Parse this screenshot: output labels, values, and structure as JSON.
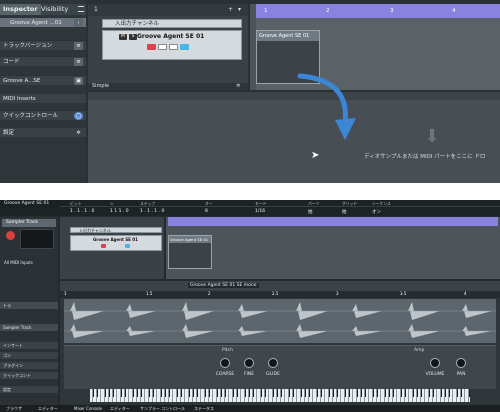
{
  "top": {
    "inspector": {
      "tabs": [
        "Inspector",
        "Visibility"
      ],
      "menu_icon": "hamburger-icon",
      "track_name": "Groove Agent ...01",
      "rows": [
        "トラックバージョン",
        "コード",
        "Groove A...SE",
        "MIDI Inserts",
        "クイックコントロール",
        "設定"
      ]
    },
    "tracklist": {
      "title": "入出力チャンネル",
      "track_name": "Groove Agent SE 01",
      "buttons": [
        "M",
        "S"
      ],
      "footer": "Simple",
      "plus": "+",
      "count": "1"
    },
    "ruler": {
      "marks": [
        "1",
        "2",
        "3",
        "4"
      ]
    },
    "clip_title": "Groove Agent SE 01",
    "drop_hint": "ディオサンプルまたは MIDI パートをここに ドロ"
  },
  "bottom": {
    "project_title": "Groove Agent SE 01",
    "toolbar_labels": [
      "ビット",
      "シ",
      "ステップ",
      "オー",
      "モード",
      "パーツ",
      "グリッド",
      "シーケンス"
    ],
    "toolbar_values": [
      "1 . 1 . 1 . 0",
      "1 1 1 . 0",
      "1 . 1 . 1 . 0",
      "8",
      "1/16",
      "拍",
      "拍",
      "オン"
    ],
    "inspector": {
      "tab_label": "Sampler Track",
      "rows": [
        "All MIDI Inputs",
        "Sampler Track",
        "トラ",
        "インサート",
        "ゴン",
        "プラグイン",
        "クイックコント",
        "設定"
      ]
    },
    "tracklist_title": "入出力チャンネル",
    "track_name": "Groove Agent SE 01",
    "clip_title": "Groove Agent SE 01",
    "ruler2": {
      "marks": [
        "1",
        "1.5",
        "2",
        "2.5",
        "3",
        "3.5",
        "4"
      ]
    },
    "editor_toolbar_title": "Groove Agent SE 01 SE mono",
    "pitch_section": "Pitch",
    "amp_section": "Amp",
    "knobs": [
      "COARSE",
      "FINE",
      "GLIDE",
      "VOLUME",
      "PAN"
    ],
    "statusbar": [
      "ブラウザ",
      "エディター",
      "Mixer Console",
      "エディター",
      "サンプラー コントロール",
      "ステータス"
    ]
  }
}
